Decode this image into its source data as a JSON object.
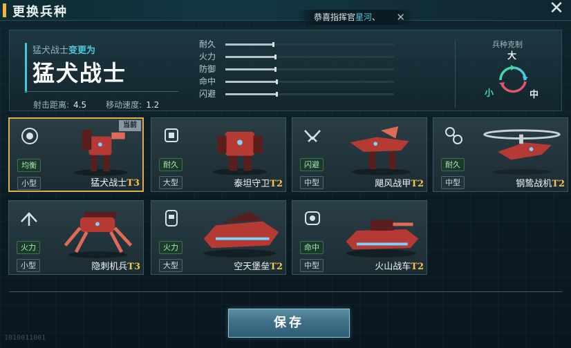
{
  "window": {
    "title": "更换兵种",
    "close_icon": "close-x-icon"
  },
  "toast": {
    "prefix": "恭喜指挥官",
    "highlight": "星河",
    "suffix": "、",
    "dismiss_icon": "close-icon"
  },
  "header": {
    "change_from": "猛犬战士",
    "change_word": "变更为",
    "unit_name": "猛犬战士",
    "range_label": "射击距离:",
    "range_value": "4.5",
    "speed_label": "移动速度:",
    "speed_value": "1.2",
    "attributes": [
      {
        "label": "耐久",
        "value": 0.28
      },
      {
        "label": "火力",
        "value": 0.29
      },
      {
        "label": "防御",
        "value": 0.29
      },
      {
        "label": "命中",
        "value": 0.3
      },
      {
        "label": "闪避",
        "value": 0.3
      }
    ]
  },
  "counter": {
    "title": "兵种克制",
    "large": "大",
    "small": "小",
    "medium": "中",
    "colors": {
      "green": "#45d7a8",
      "red": "#e2566a",
      "teal": "#4ec9d8"
    }
  },
  "units": [
    {
      "name": "猛犬战士",
      "tier": "T3",
      "trait": "均衡",
      "size": "小型",
      "selected": true,
      "current_badge": "当前",
      "icon": "class-balanced-icon"
    },
    {
      "name": "泰坦守卫",
      "tier": "T2",
      "trait": "耐久",
      "size": "大型",
      "selected": false,
      "icon": "class-durability-icon"
    },
    {
      "name": "飓风战甲",
      "tier": "T2",
      "trait": "闪避",
      "size": "中型",
      "selected": false,
      "icon": "class-evasion-icon"
    },
    {
      "name": "钢鸷战机",
      "tier": "T2",
      "trait": "耐久",
      "size": "中型",
      "selected": false,
      "icon": "class-aircraft-icon"
    },
    {
      "name": "隐刺机兵",
      "tier": "T3",
      "trait": "火力",
      "size": "小型",
      "selected": false,
      "icon": "class-stealth-icon"
    },
    {
      "name": "空天堡垒",
      "tier": "T2",
      "trait": "火力",
      "size": "大型",
      "selected": false,
      "icon": "class-fortress-icon"
    },
    {
      "name": "火山战车",
      "tier": "T2",
      "trait": "命中",
      "size": "中型",
      "selected": false,
      "icon": "class-vehicle-icon"
    }
  ],
  "save_button": "保存",
  "footer_code": "1010011001"
}
